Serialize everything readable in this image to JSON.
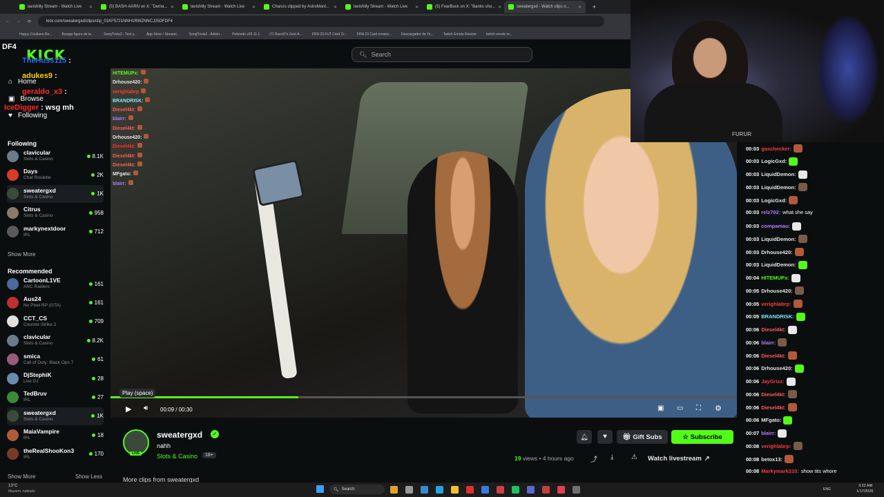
{
  "browser": {
    "tabs": [
      {
        "label": "lavishlily Stream - Watch Live",
        "active": false
      },
      {
        "label": "(5) BASH-AARN on X: \"Dema...",
        "active": false
      },
      {
        "label": "lavishlily Stream - Watch Live",
        "active": false
      },
      {
        "label": "Chanzo clipped by AstroMont...",
        "active": false
      },
      {
        "label": "lavishlily Stream - Watch Live",
        "active": false
      },
      {
        "label": "(5) FearBuck on X: \"Banks sho...",
        "active": false
      },
      {
        "label": "sweatergxd - Watch clips o...",
        "active": true
      }
    ],
    "url": "kick.com/sweatergxd/clips/clip_01KF5721NNH1RWZNNCJ25DFDF4",
    "bookmarks": [
      "Happy Cristiano Ro...",
      "Burago figura de te...",
      "SongTrivia2 - Test y...",
      "App Store / Streami...",
      "SongTrivia2 - Adivin...",
      "Peletodo v25.11.1",
      "(7) Razo97s Zest-A...",
      "FIFA 23 FUT Card Cr...",
      "FIFA 23 Card creator...",
      "Descargador de Yo...",
      "Twitch Emote Resizer",
      "twitch emote m..."
    ]
  },
  "site": {
    "logo": "KICK",
    "search_placeholder": "Search"
  },
  "overlay_top": {
    "tag": "DF4",
    "lines": [
      {
        "user": "TheHuss115",
        "text": "",
        "color": "#2f6bff"
      },
      {
        "user": "adukes9",
        "text": "",
        "color": "#ffd400"
      },
      {
        "user": "geraldo_x3",
        "text": "",
        "color": "#ff3030"
      },
      {
        "user": "IceDigger",
        "text": "wsg mh",
        "color": "#ff2a2a"
      }
    ]
  },
  "nav": {
    "home": "Home",
    "browse": "Browse",
    "following": "Following"
  },
  "sidebar": {
    "following_title": "Following",
    "following": [
      {
        "name": "clavicular",
        "category": "Slots & Casino",
        "viewers": "8.1K",
        "color": "#6a7c8a"
      },
      {
        "name": "Days",
        "category": "Chat Roulette",
        "viewers": "2K",
        "color": "#d63b2b"
      },
      {
        "name": "sweatergxd",
        "category": "Slots & Casino",
        "viewers": "1K",
        "color": "#3b4b3b"
      },
      {
        "name": "Citrus",
        "category": "Slots & Casino",
        "viewers": "958",
        "color": "#8a7a6a"
      },
      {
        "name": "markynextdoor",
        "category": "IRL",
        "viewers": "712",
        "color": "#5a5a5a"
      }
    ],
    "show_more_1": "Show More",
    "recommended_title": "Recommended",
    "recommended": [
      {
        "name": "CartoonL1VE",
        "category": "ARC Raiders",
        "viewers": "161",
        "color": "#4a6aa0"
      },
      {
        "name": "Aus24",
        "category": "No Pixel RP (GTA)",
        "viewers": "161",
        "color": "#c03030"
      },
      {
        "name": "CCT_CS",
        "category": "Counter-Strike 2",
        "viewers": "709",
        "color": "#e0e0e0"
      },
      {
        "name": "clavicular",
        "category": "Slots & Casino",
        "viewers": "8.2K",
        "color": "#6a7c8a"
      },
      {
        "name": "smica",
        "category": "Call of Duty: Black Ops 7",
        "viewers": "61",
        "color": "#9a5a7a"
      },
      {
        "name": "DjStephiK",
        "category": "Live DJ",
        "viewers": "28",
        "color": "#6a8ab0"
      },
      {
        "name": "TedBruv",
        "category": "IRL",
        "viewers": "27",
        "color": "#3a8a3a"
      },
      {
        "name": "sweatergxd",
        "category": "Slots & Casino",
        "viewers": "1K",
        "color": "#3b4b3b"
      },
      {
        "name": "MaiaVampire",
        "category": "IRL",
        "viewers": "18",
        "color": "#b05a3a"
      },
      {
        "name": "theRealShooKon3",
        "category": "IRL",
        "viewers": "170",
        "color": "#7a3a2a"
      }
    ],
    "show_more_2": "Show More",
    "show_less": "Show Less"
  },
  "video_chat_overlay": [
    {
      "user": "HITEMUPx:",
      "color": "#53fc18"
    },
    {
      "user": "Drhouse420:",
      "color": "#e6e6e6"
    },
    {
      "user": "verighlabrp",
      "color": "#ff3a3a"
    },
    {
      "user": "BRANDRISK:",
      "color": "#7fe8ff"
    },
    {
      "user": "Diesel4kt:",
      "color": "#ff5a5a"
    },
    {
      "user": "blairr:",
      "color": "#b57bff"
    },
    {
      "user": "Diesel4kt:",
      "color": "#ff5a5a"
    },
    {
      "user": "Drhouse420:",
      "color": "#e6e6e6"
    },
    {
      "user": "Diesel4kt:",
      "color": "#ff3030"
    },
    {
      "user": "Diesel4kt:",
      "color": "#ff5a5a"
    },
    {
      "user": "Diesel4kt:",
      "color": "#ff5a5a"
    },
    {
      "user": "MFgato:",
      "color": "#e6e6e6"
    },
    {
      "user": "blairr:",
      "color": "#b57bff"
    }
  ],
  "player": {
    "tooltip": "Play (space)",
    "time": "00:09 / 00:30",
    "progress": 0.3
  },
  "clip": {
    "streamer": "sweatergxd",
    "title": "nahh",
    "category": "Slots & Casino",
    "age_badge": "18+",
    "live_badge": "LIVE",
    "views_count": "19",
    "views_label": "views",
    "time_ago": "4 hours ago",
    "gift_subs": "Gift Subs",
    "subscribe": "Subscribe",
    "watch_livestream": "Watch livestream",
    "more_clips": "More clips from sweatergxd"
  },
  "webcam": {
    "shirt_text": "FURUR"
  },
  "right_chat": [
    {
      "time": "00:03",
      "user": "gaschecker:",
      "text": "",
      "color": "#ff3a3a"
    },
    {
      "time": "00:03",
      "user": "LogicGxd:",
      "text": "",
      "color": "#e6e6e6"
    },
    {
      "time": "00:03",
      "user": "LiquidDemon:",
      "text": "",
      "color": "#e6e6e6"
    },
    {
      "time": "00:03",
      "user": "LiquidDemon:",
      "text": "",
      "color": "#e6e6e6"
    },
    {
      "time": "00:03",
      "user": "LogicGxd:",
      "text": "",
      "color": "#e6e6e6"
    },
    {
      "time": "00:03",
      "user": "relz702:",
      "text": "what she say",
      "color": "#b57bff"
    },
    {
      "time": "00:03",
      "user": "compamau:",
      "text": "",
      "color": "#b57bff"
    },
    {
      "time": "00:03",
      "user": "LiquidDemon:",
      "text": "",
      "color": "#e6e6e6"
    },
    {
      "time": "00:03",
      "user": "Drhouse420:",
      "text": "",
      "color": "#e6e6e6"
    },
    {
      "time": "00:03",
      "user": "LiquidDemon:",
      "text": "",
      "color": "#e6e6e6"
    },
    {
      "time": "00:04",
      "user": "HITEMUPx:",
      "text": "",
      "color": "#53fc18"
    },
    {
      "time": "00:05",
      "user": "Drhouse420:",
      "text": "",
      "color": "#e6e6e6"
    },
    {
      "time": "00:05",
      "user": "verighlabrp:",
      "text": "",
      "color": "#ff3a3a"
    },
    {
      "time": "00:05",
      "user": "BRANDRISK:",
      "text": "",
      "color": "#7fe8ff"
    },
    {
      "time": "00:06",
      "user": "Diesel4kt:",
      "text": "",
      "color": "#ff5a5a"
    },
    {
      "time": "00:06",
      "user": "blairr:",
      "text": "",
      "color": "#b57bff"
    },
    {
      "time": "00:06",
      "user": "Diesel4kt:",
      "text": "",
      "color": "#ff5a5a"
    },
    {
      "time": "00:06",
      "user": "Drhouse420:",
      "text": "",
      "color": "#e6e6e6"
    },
    {
      "time": "00:06",
      "user": "JayGrizz:",
      "text": "",
      "color": "#ff3a3a"
    },
    {
      "time": "00:06",
      "user": "Diesel4kt:",
      "text": "",
      "color": "#ff5a5a"
    },
    {
      "time": "00:06",
      "user": "Diesel4kt:",
      "text": "",
      "color": "#ff5a5a"
    },
    {
      "time": "00:06",
      "user": "MFgato:",
      "text": "",
      "color": "#e6e6e6"
    },
    {
      "time": "00:07",
      "user": "blairr:",
      "text": "",
      "color": "#b57bff"
    },
    {
      "time": "00:08",
      "user": "verighlabrp:",
      "text": "",
      "color": "#ff3a3a"
    },
    {
      "time": "00:08",
      "user": "betox13:",
      "text": "",
      "color": "#e6e6e6"
    },
    {
      "time": "00:08",
      "user": "Markymark310:",
      "text": "show tits whore",
      "color": "#ff3a3a"
    }
  ],
  "taskbar": {
    "weather_temp": "13°C",
    "weather_desc": "Mayorm. nublado",
    "search": "Search",
    "lang": "ENG",
    "clock_time": "3:22 AM",
    "clock_date": "1/17/2026"
  },
  "colors": {
    "kick_green": "#53fc18",
    "bg": "#0b0e0f"
  }
}
